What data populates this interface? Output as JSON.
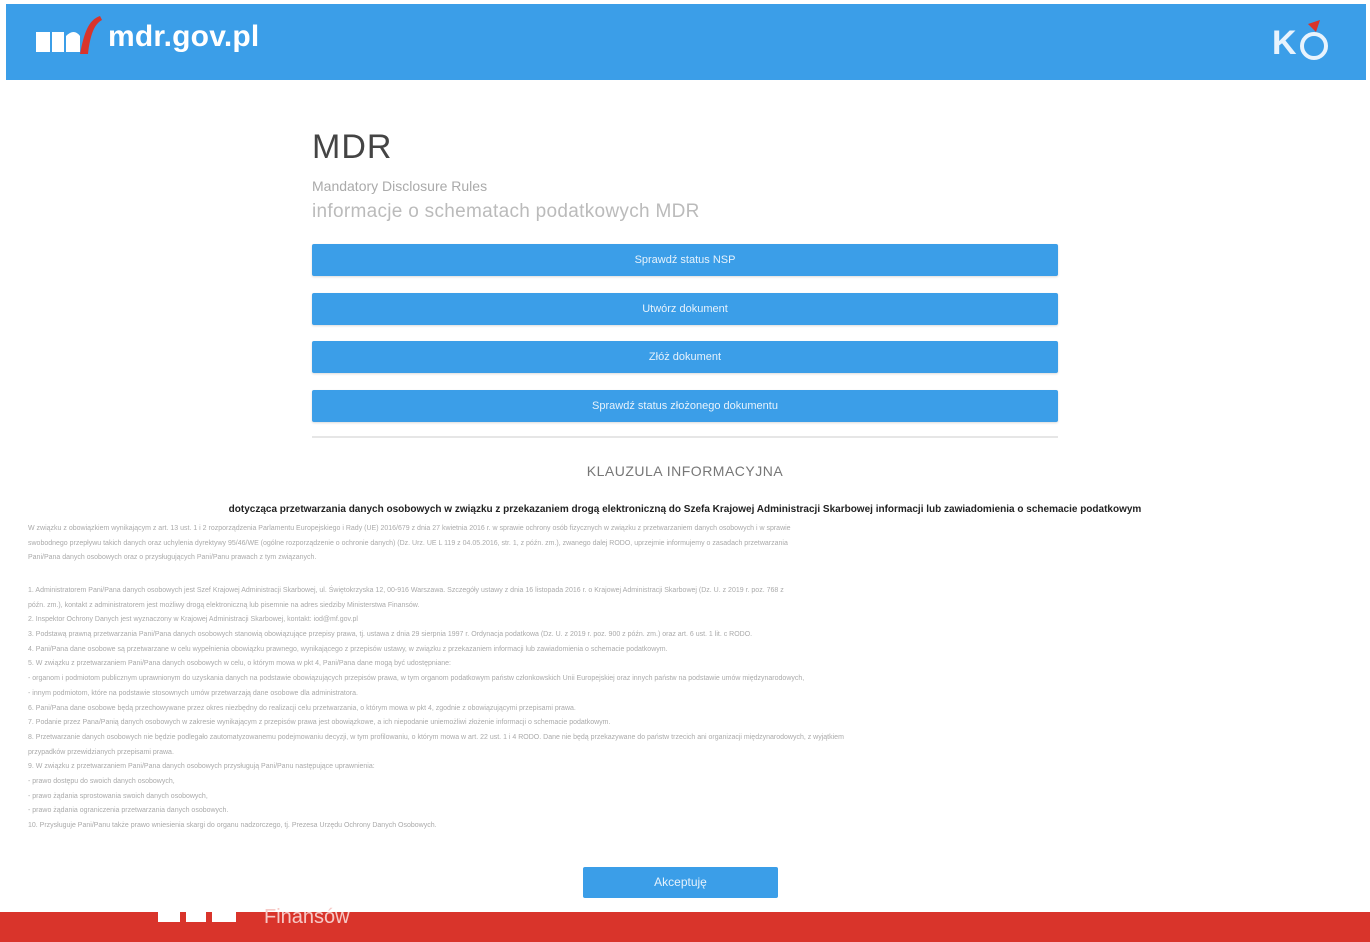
{
  "header": {
    "site_name": "mdr.gov.pl",
    "logo_icon": "mf-logo-icon",
    "kas_icon": "kas-logo-icon",
    "brand_color": "#3b9ee8"
  },
  "main": {
    "title": "MDR",
    "subtitle_1": "Mandatory Disclosure Rules",
    "subtitle_2": "informacje o schematach podatkowych MDR",
    "buttons": [
      {
        "label": "Sprawdź status NSP"
      },
      {
        "label": "Utwórz dokument"
      },
      {
        "label": "Złóż dokument"
      },
      {
        "label": "Sprawdź status złożonego dokumentu"
      }
    ]
  },
  "clause": {
    "title": "KLAUZULA INFORMACYJNA",
    "heading": "dotycząca przetwarzania danych osobowych w związku z przekazaniem drogą elektroniczną do Szefa Krajowej Administracji Skarbowej informacji lub zawiadomienia o schemacie podatkowym",
    "intro_lines": [
      "W związku z obowiązkiem wynikającym z art. 13 ust. 1 i 2 rozporządzenia Parlamentu Europejskiego i Rady (UE) 2016/679 z dnia 27 kwietnia 2016 r. w sprawie ochrony osób fizycznych w związku z przetwarzaniem danych osobowych i w sprawie",
      "swobodnego przepływu takich danych oraz uchylenia dyrektywy 95/46/WE (ogólne rozporządzenie o ochronie danych) (Dz. Urz. UE L 119 z 04.05.2016, str. 1, z późn. zm.), zwanego dalej RODO, uprzejmie informujemy o zasadach przetwarzania",
      "Pani/Pana danych osobowych oraz o przysługujących Pani/Panu prawach z tym związanych."
    ],
    "numbered_lines": [
      "1. Administratorem Pani/Pana danych osobowych jest Szef Krajowej Administracji Skarbowej, ul. Świętokrzyska 12, 00-916 Warszawa. Szczegóły ustawy z dnia 16 listopada 2016 r. o Krajowej Administracji Skarbowej (Dz. U. z 2019 r. poz. 768 z",
      "późn. zm.), kontakt z administratorem jest możliwy drogą elektroniczną lub pisemnie na adres siedziby Ministerstwa Finansów.",
      "2. Inspektor Ochrony Danych jest wyznaczony w Krajowej Administracji Skarbowej, kontakt: iod@mf.gov.pl",
      "3. Podstawą prawną przetwarzania Pani/Pana danych osobowych stanowią obowiązujące przepisy prawa, tj. ustawa z dnia 29 sierpnia 1997 r. Ordynacja podatkowa (Dz. U. z 2019 r. poz. 900 z późn. zm.) oraz art. 6 ust. 1 lit. c RODO.",
      "4. Pani/Pana dane osobowe są przetwarzane w celu wypełnienia obowiązku prawnego, wynikającego z przepisów ustawy, w związku z przekazaniem informacji lub zawiadomienia o schemacie podatkowym.",
      "5. W związku z przetwarzaniem Pani/Pana danych osobowych w celu, o którym mowa w pkt 4, Pani/Pana dane mogą być udostępniane:",
      "- organom i podmiotom publicznym uprawnionym do uzyskania danych na podstawie obowiązujących przepisów prawa, w tym organom podatkowym państw członkowskich Unii Europejskiej oraz innych państw na podstawie umów międzynarodowych,",
      "- innym podmiotom, które na podstawie stosownych umów przetwarzają dane osobowe dla administratora.",
      "6. Pani/Pana dane osobowe będą przechowywane przez okres niezbędny do realizacji celu przetwarzania, o którym mowa w pkt 4, zgodnie z obowiązującymi przepisami prawa.",
      "7. Podanie przez Pana/Panią danych osobowych w zakresie wynikającym z przepisów prawa jest obowiązkowe, a ich niepodanie uniemożliwi złożenie informacji o schemacie podatkowym.",
      "8. Przetwarzanie danych osobowych nie będzie podlegało zautomatyzowanemu podejmowaniu decyzji, w tym profilowaniu, o którym mowa w art. 22 ust. 1 i 4 RODO. Dane nie będą przekazywane do państw trzecich ani organizacji międzynarodowych, z wyjątkiem",
      "przypadków przewidzianych przepisami prawa.",
      "9. W związku z przetwarzaniem Pani/Pana danych osobowych przysługują Pani/Panu następujące uprawnienia:",
      "- prawo dostępu do swoich danych osobowych,",
      "- prawo żądania sprostowania swoich danych osobowych,",
      "- prawo żądania ograniczenia przetwarzania danych osobowych.",
      "10. Przysługuje Pani/Panu także prawo wniesienia skargi do organu nadzorczego, tj. Prezesa Urzędu Ochrony Danych Osobowych."
    ]
  },
  "accept_label": "Akceptuję",
  "footer": {
    "text": "Finansów",
    "color": "#d9342b"
  }
}
